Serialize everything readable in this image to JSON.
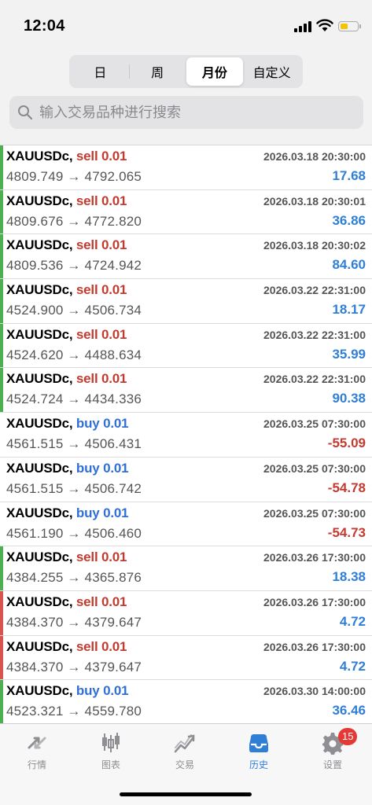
{
  "status": {
    "time": "12:04",
    "battery_color": "#f5c400"
  },
  "segments": [
    {
      "label": "日",
      "active": false
    },
    {
      "label": "周",
      "active": false
    },
    {
      "label": "月份",
      "active": true
    },
    {
      "label": "自定义",
      "active": false
    }
  ],
  "search": {
    "placeholder": "输入交易品种进行搜索",
    "icon": "search-icon"
  },
  "colors": {
    "sell": "#c33b2f",
    "buy": "#2f6fd6",
    "profit_pos": "#2f7fd6",
    "profit_neg": "#c33b2f",
    "bar_green": "#4caf50",
    "bar_red": "#d9534f"
  },
  "trades": [
    {
      "symbol": "XAUUSDc,",
      "side": "sell",
      "volume": "0.01",
      "prices": "4809.749 → 4792.065",
      "time": "2026.03.18 20:30:00",
      "profit": "17.68",
      "bar": "green"
    },
    {
      "symbol": "XAUUSDc,",
      "side": "sell",
      "volume": "0.01",
      "prices": "4809.676 → 4772.820",
      "time": "2026.03.18 20:30:01",
      "profit": "36.86",
      "bar": "green"
    },
    {
      "symbol": "XAUUSDc,",
      "side": "sell",
      "volume": "0.01",
      "prices": "4809.536 → 4724.942",
      "time": "2026.03.18 20:30:02",
      "profit": "84.60",
      "bar": "green"
    },
    {
      "symbol": "XAUUSDc,",
      "side": "sell",
      "volume": "0.01",
      "prices": "4524.900 → 4506.734",
      "time": "2026.03.22 22:31:00",
      "profit": "18.17",
      "bar": "green"
    },
    {
      "symbol": "XAUUSDc,",
      "side": "sell",
      "volume": "0.01",
      "prices": "4524.620 → 4488.634",
      "time": "2026.03.22 22:31:00",
      "profit": "35.99",
      "bar": "green"
    },
    {
      "symbol": "XAUUSDc,",
      "side": "sell",
      "volume": "0.01",
      "prices": "4524.724 → 4434.336",
      "time": "2026.03.22 22:31:00",
      "profit": "90.38",
      "bar": "green"
    },
    {
      "symbol": "XAUUSDc,",
      "side": "buy",
      "volume": "0.01",
      "prices": "4561.515 → 4506.431",
      "time": "2026.03.25 07:30:00",
      "profit": "-55.09",
      "bar": "none"
    },
    {
      "symbol": "XAUUSDc,",
      "side": "buy",
      "volume": "0.01",
      "prices": "4561.515 → 4506.742",
      "time": "2026.03.25 07:30:00",
      "profit": "-54.78",
      "bar": "none"
    },
    {
      "symbol": "XAUUSDc,",
      "side": "buy",
      "volume": "0.01",
      "prices": "4561.190 → 4506.460",
      "time": "2026.03.25 07:30:00",
      "profit": "-54.73",
      "bar": "none"
    },
    {
      "symbol": "XAUUSDc,",
      "side": "sell",
      "volume": "0.01",
      "prices": "4384.255 → 4365.876",
      "time": "2026.03.26 17:30:00",
      "profit": "18.38",
      "bar": "green"
    },
    {
      "symbol": "XAUUSDc,",
      "side": "sell",
      "volume": "0.01",
      "prices": "4384.370 → 4379.647",
      "time": "2026.03.26 17:30:00",
      "profit": "4.72",
      "bar": "red"
    },
    {
      "symbol": "XAUUSDc,",
      "side": "sell",
      "volume": "0.01",
      "prices": "4384.370 → 4379.647",
      "time": "2026.03.26 17:30:00",
      "profit": "4.72",
      "bar": "red"
    },
    {
      "symbol": "XAUUSDc,",
      "side": "buy",
      "volume": "0.01",
      "prices": "4523.321 → 4559.780",
      "time": "2026.03.30 14:00:00",
      "profit": "36.46",
      "bar": "green"
    }
  ],
  "tabbar": [
    {
      "label": "行情",
      "icon": "quotes-icon",
      "active": false
    },
    {
      "label": "图表",
      "icon": "chart-icon",
      "active": false
    },
    {
      "label": "交易",
      "icon": "trade-icon",
      "active": false
    },
    {
      "label": "历史",
      "icon": "history-icon",
      "active": true
    },
    {
      "label": "设置",
      "icon": "gear-icon",
      "active": false,
      "badge": "15"
    }
  ]
}
